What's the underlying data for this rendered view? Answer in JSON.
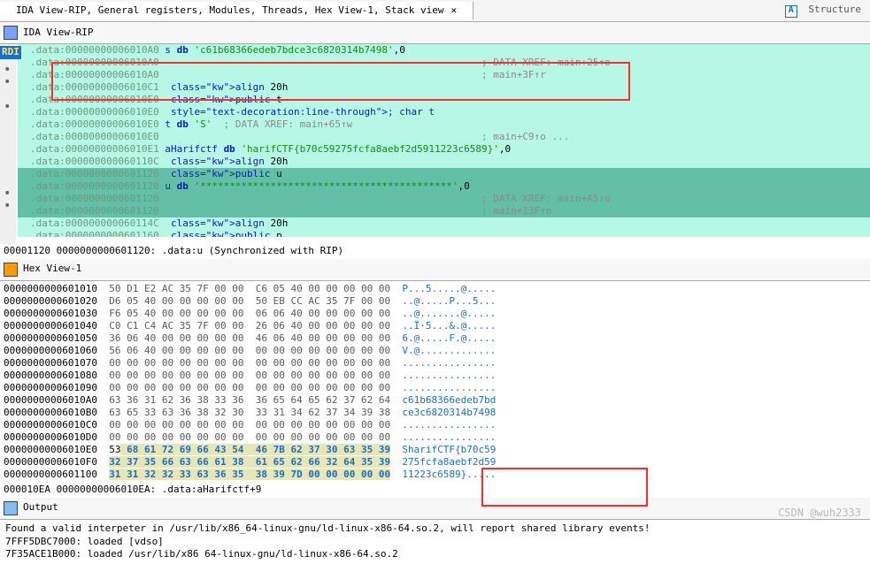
{
  "tabs": {
    "main": "IDA View-RIP, General registers, Modules, Threads, Hex View-1, Stack view",
    "right": "Structure"
  },
  "ida_panel_title": "IDA View-RIP",
  "hex_panel_title": "Hex View-1",
  "output_panel_title": "Output",
  "rdi_tag": "RDI",
  "ida_rows": [
    {
      "addr": ".data:00000000006010A0",
      "txt": "s db 'c61b68366edeb7bdce3c6820314b7498',0"
    },
    {
      "addr": ".data:00000000006010A0",
      "cmt": "; DATA XREF: main+25↑o"
    },
    {
      "addr": ".data:00000000006010A0",
      "cmt": "; main+3F↑r"
    },
    {
      "addr": ".data:00000000006010C1",
      "txt": "align 20h"
    },
    {
      "addr": ".data:00000000006010E0",
      "txt": "public t"
    },
    {
      "addr": ".data:00000000006010E0",
      "txt": "; char t",
      "strike": true
    },
    {
      "addr": ".data:00000000006010E0",
      "txt": "t db 'S'",
      "cmt": "; DATA XREF: main+65↑w"
    },
    {
      "addr": ".data:00000000006010E0",
      "cmt": "; main+C9↑o ..."
    },
    {
      "addr": ".data:00000000006010E1",
      "txt": "aHarifctf db 'harifCTF{b70c59275fcfa8aebf2d5911223c6589}',0"
    },
    {
      "addr": ".data:000000000060110C",
      "txt": "align 20h"
    },
    {
      "addr": ".data:0000000000601120",
      "txt": "public u",
      "sel": true
    },
    {
      "addr": ".data:0000000000601120",
      "txt": "u db '*******************************************',0",
      "sel": true
    },
    {
      "addr": ".data:0000000000601120",
      "cmt": "; DATA XREF: main+A5↑o",
      "sel": true
    },
    {
      "addr": ".data:0000000000601120",
      "cmt": "; main+13F↑o",
      "sel": true
    },
    {
      "addr": ".data:000000000060114C",
      "txt": "align 20h"
    },
    {
      "addr": ".data:0000000000601160",
      "txt": "public p",
      "cut": true
    }
  ],
  "sync_line": "00001120 0000000000601120: .data:u (Synchronized with RIP)",
  "hex_lines": [
    {
      "addr": "0000000000601010",
      "bytes": "50 D1 E2 AC 35 7F 00 00  C6 05 40 00 00 00 00 00",
      "asc": "P...5.....@....."
    },
    {
      "addr": "0000000000601020",
      "bytes": "D6 05 40 00 00 00 00 00  50 EB CC AC 35 7F 00 00",
      "asc": "..@.....P...5..."
    },
    {
      "addr": "0000000000601030",
      "bytes": "F6 05 40 00 00 00 00 00  06 06 40 00 00 00 00 00",
      "asc": "..@.......@....."
    },
    {
      "addr": "0000000000601040",
      "bytes": "C0 C1 C4 AC 35 7F 00 00  26 06 40 00 00 00 00 00",
      "asc": "..Ï·5...&.@....."
    },
    {
      "addr": "0000000000601050",
      "bytes": "36 06 40 00 00 00 00 00  46 06 40 00 00 00 00 00",
      "asc": "6.@.....F.@....."
    },
    {
      "addr": "0000000000601060",
      "bytes": "56 06 40 00 00 00 00 00  00 00 00 00 00 00 00 00",
      "asc": "V.@............."
    },
    {
      "addr": "0000000000601070",
      "bytes": "00 00 00 00 00 00 00 00  00 00 00 00 00 00 00 00",
      "asc": "................"
    },
    {
      "addr": "0000000000601080",
      "bytes": "00 00 00 00 00 00 00 00  00 00 00 00 00 00 00 00",
      "asc": "................"
    },
    {
      "addr": "0000000000601090",
      "bytes": "00 00 00 00 00 00 00 00  00 00 00 00 00 00 00 00",
      "asc": "................"
    },
    {
      "addr": "00000000006010A0",
      "bytes": "63 36 31 62 36 38 33 36  36 65 64 65 62 37 62 64",
      "asc": "c61b68366edeb7bd"
    },
    {
      "addr": "00000000006010B0",
      "bytes": "63 65 33 63 36 38 32 30  33 31 34 62 37 34 39 38",
      "asc": "ce3c6820314b7498"
    },
    {
      "addr": "00000000006010C0",
      "bytes": "00 00 00 00 00 00 00 00  00 00 00 00 00 00 00 00",
      "asc": "................"
    },
    {
      "addr": "00000000006010D0",
      "bytes": "00 00 00 00 00 00 00 00  00 00 00 00 00 00 00 00",
      "asc": "................"
    },
    {
      "addr": "00000000006010E0",
      "bytes": "53 68 61 72 69 66 43 54  46 7B 62 37 30 63 35 39",
      "asc": "SharifCTF{b70c59",
      "hi": true,
      "cursor": true
    },
    {
      "addr": "00000000006010F0",
      "bytes": "32 37 35 66 63 66 61 38  61 65 62 66 32 64 35 39",
      "asc": "275fcfa8aebf2d59",
      "hi": true
    },
    {
      "addr": "0000000000601100",
      "bytes": "31 31 32 32 33 63 36 35  38 39 7D 00 00 00 00 00",
      "asc": "11223c6589}.....",
      "hi": true
    }
  ],
  "sync_hex": "000010EA 00000000006010EA: .data:aHarifctf+9",
  "output_lines": [
    "Found a valid interpeter in /usr/lib/x86_64-linux-gnu/ld-linux-x86-64.so.2, will report shared library events!",
    "7FFF5DBC7000: loaded [vdso]",
    "7F35ACE1B000: loaded /usr/lib/x86 64-linux-gnu/ld-linux-x86-64.so.2"
  ],
  "watermark": "CSDN @wuh2333"
}
